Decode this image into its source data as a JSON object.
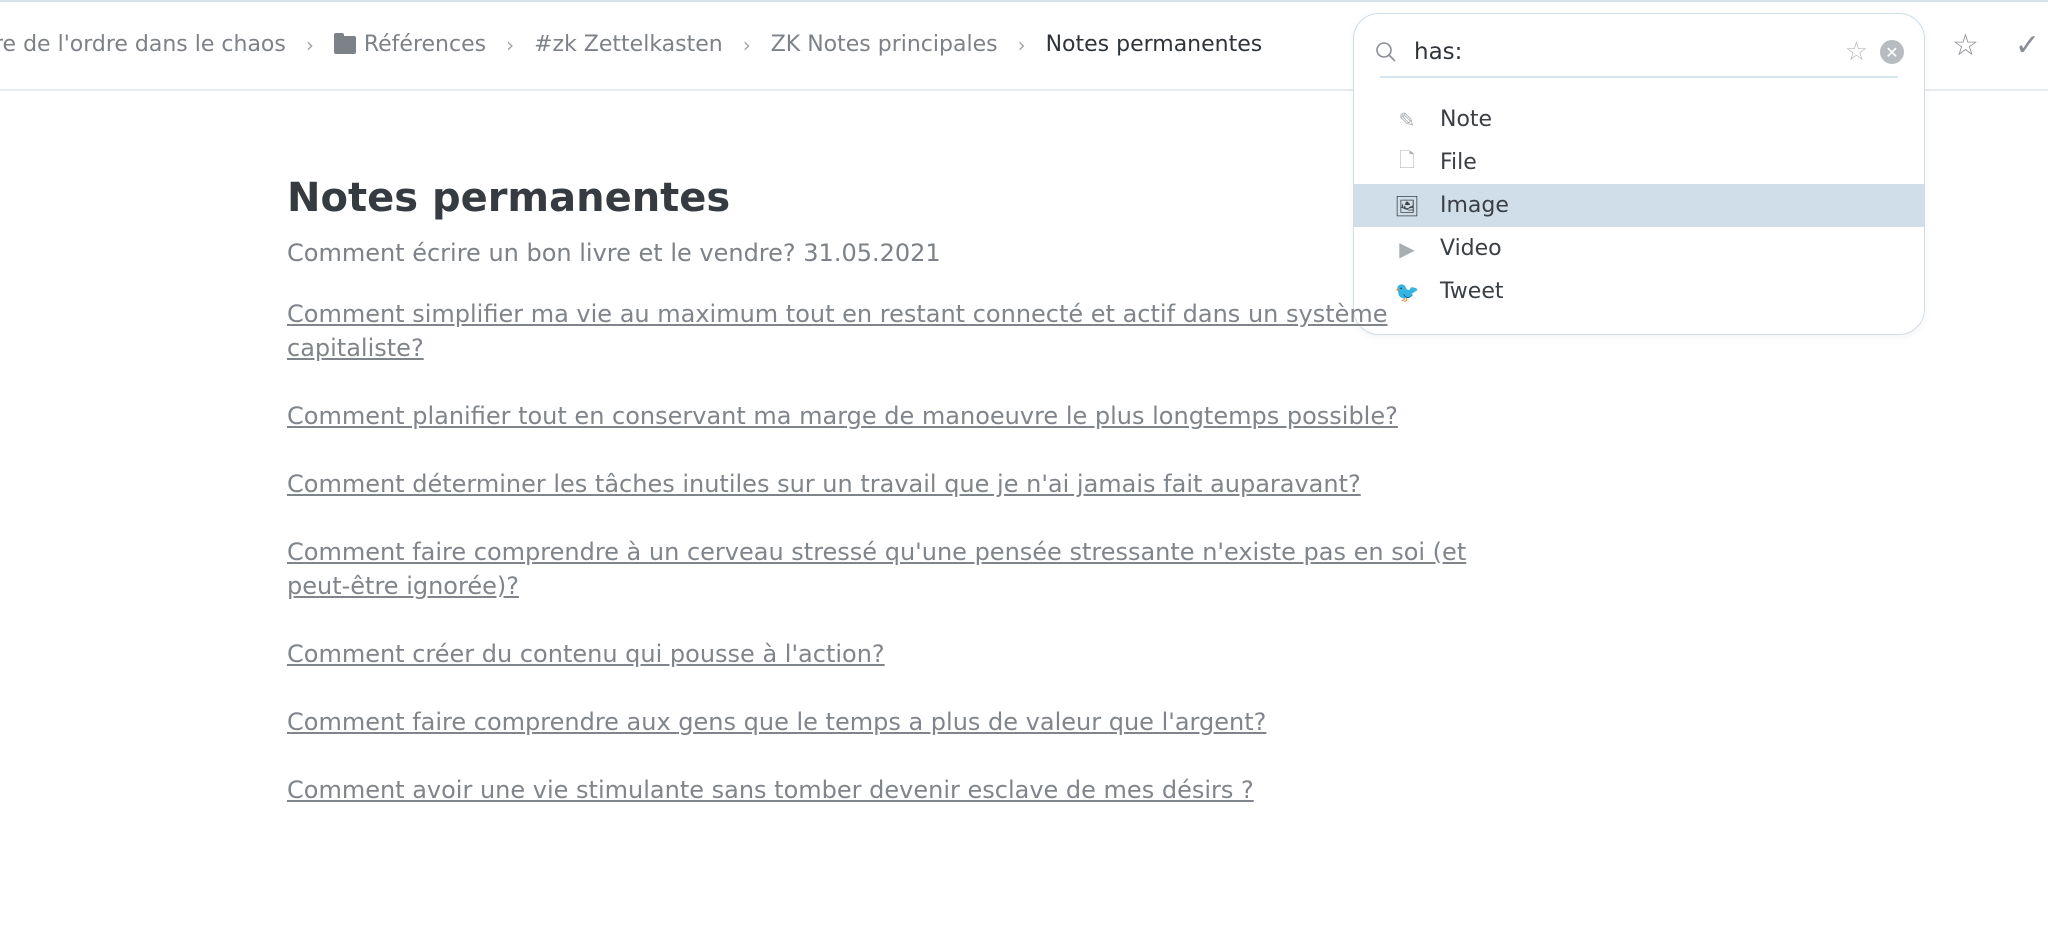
{
  "breadcrumb": [
    {
      "label": "re de l'ordre dans le chaos",
      "icon": null
    },
    {
      "label": "Références",
      "icon": "folder-icon"
    },
    {
      "label": "#zk Zettelkasten",
      "icon": null
    },
    {
      "label": "ZK Notes principales",
      "icon": null
    },
    {
      "label": "Notes permanentes",
      "icon": null,
      "current": true
    }
  ],
  "search": {
    "value": "has:",
    "icons": [
      "search-icon",
      "star-icon",
      "clear-icon"
    ]
  },
  "suggestions": [
    {
      "label": "Note",
      "icon": "pencil-icon",
      "glyph": "✎"
    },
    {
      "label": "File",
      "icon": "file-icon",
      "glyph": "🗋"
    },
    {
      "label": "Image",
      "icon": "image-icon",
      "glyph": "🖼",
      "active": true
    },
    {
      "label": "Video",
      "icon": "video-icon",
      "glyph": "▶"
    },
    {
      "label": "Tweet",
      "icon": "twitter-icon",
      "glyph": "🐦"
    }
  ],
  "toolbar": {
    "star": "☆",
    "check": "✓"
  },
  "note": {
    "title": "Notes permanentes",
    "subtitle": "Comment écrire un bon livre et le vendre? 31.05.2021",
    "links": [
      "Comment simplifier ma vie au maximum tout en restant connecté et actif dans un système capitaliste?",
      "Comment planifier tout en conservant ma marge de manoeuvre le plus longtemps possible?",
      "Comment déterminer les tâches inutiles sur un travail que je n'ai jamais fait auparavant?",
      "Comment faire comprendre à un cerveau stressé qu'une pensée stressante n'existe pas en soi (et peut-être ignorée)?",
      "Comment créer du contenu qui pousse à l'action?",
      "Comment faire comprendre aux gens que le temps a plus de valeur que l'argent?",
      "Comment avoir une vie stimulante sans tomber devenir esclave de mes désirs ?"
    ]
  }
}
